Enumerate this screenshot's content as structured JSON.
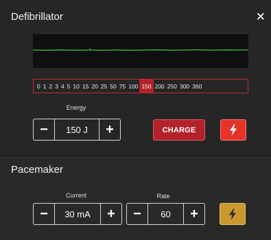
{
  "defibrillator": {
    "title": "Defibrillator",
    "energy_scale": [
      "0",
      "1",
      "2",
      "3",
      "4",
      "5",
      "10",
      "15",
      "20",
      "25",
      "50",
      "75",
      "100",
      "150",
      "200",
      "250",
      "300",
      "360"
    ],
    "energy_selected_index": 13,
    "energy_label": "Energy",
    "energy_value": "150 J",
    "decrement_label": "−",
    "increment_label": "+",
    "charge_label": "CHARGE",
    "colors": {
      "accent_red": "#b3222b",
      "shock_red": "#e5332a",
      "ecg_green": "#3fbf3f"
    }
  },
  "pacemaker": {
    "title": "Pacemaker",
    "current_label": "Current",
    "current_value": "30 mA",
    "rate_label": "Rate",
    "rate_value": "60",
    "decrement_label": "−",
    "increment_label": "+",
    "colors": {
      "pace_button": "#c9982e"
    }
  },
  "icons": {
    "close": "close-icon",
    "shock": "lightning-bolt-icon"
  }
}
